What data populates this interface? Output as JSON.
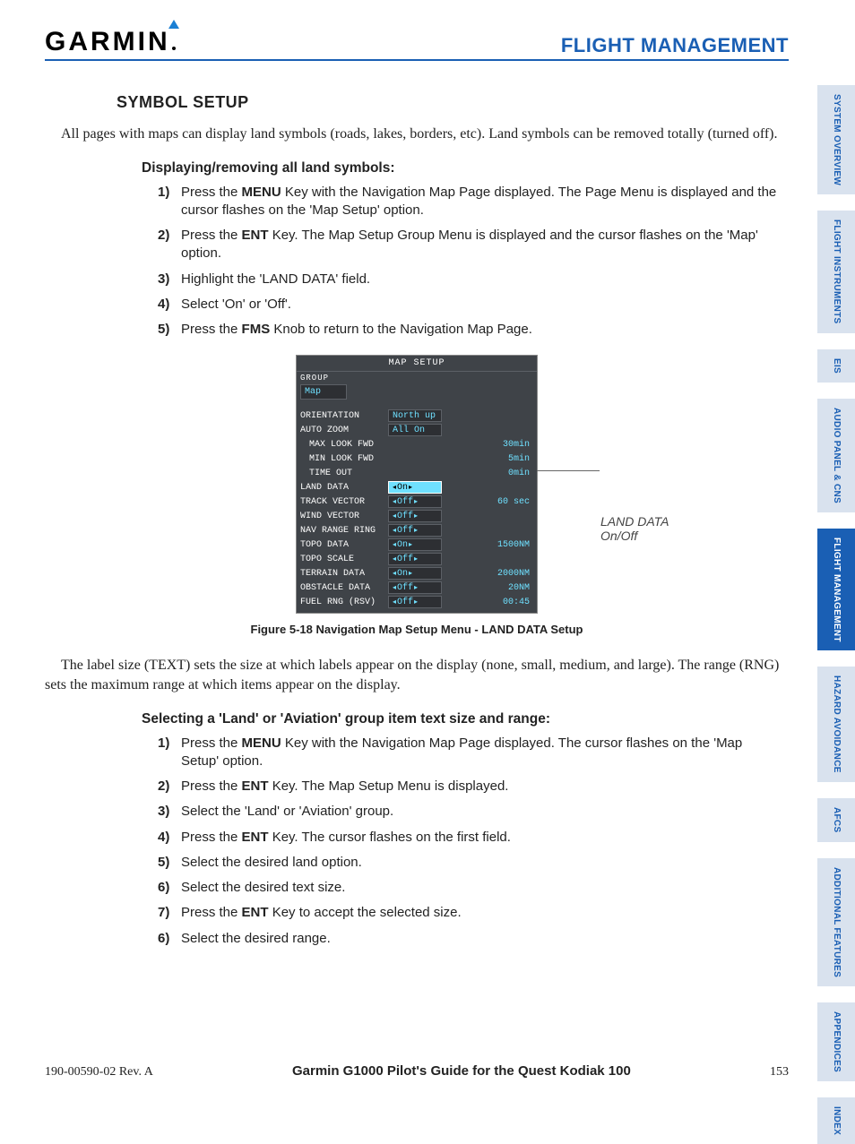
{
  "header": {
    "logo": "GARMIN",
    "chapter": "FLIGHT MANAGEMENT"
  },
  "section_title": "SYMBOL SETUP",
  "para1": "All pages with maps can display land symbols (roads, lakes, borders, etc).  Land symbols can be removed totally (turned off).",
  "subhead1": "Displaying/removing all land symbols:",
  "steps1": [
    {
      "n": "1)",
      "pre": "Press the ",
      "key": "MENU",
      "post": " Key with the Navigation Map Page displayed.  The Page Menu is displayed and the cursor flashes on the 'Map Setup' option."
    },
    {
      "n": "2)",
      "pre": "Press the ",
      "key": "ENT",
      "post": " Key.  The Map Setup Group Menu is displayed and the cursor flashes on the 'Map' option."
    },
    {
      "n": "3)",
      "pre": "",
      "key": "",
      "post": "Highlight the 'LAND DATA' field."
    },
    {
      "n": "4)",
      "pre": "",
      "key": "",
      "post": "Select 'On' or 'Off'."
    },
    {
      "n": "5)",
      "pre": "Press the ",
      "key": "FMS",
      "post": " Knob to return to the Navigation Map Page."
    }
  ],
  "figure": {
    "title": "MAP SETUP",
    "group_label": "GROUP",
    "group_value": "Map",
    "rows": [
      {
        "label": "ORIENTATION",
        "indent": false,
        "val": "North up",
        "box": true,
        "arrows": false,
        "extra": ""
      },
      {
        "label": "AUTO ZOOM",
        "indent": false,
        "val": "All On",
        "box": true,
        "arrows": false,
        "extra": ""
      },
      {
        "label": "MAX LOOK FWD",
        "indent": true,
        "val": "",
        "box": false,
        "arrows": false,
        "extra": "30min"
      },
      {
        "label": "MIN LOOK FWD",
        "indent": true,
        "val": "",
        "box": false,
        "arrows": false,
        "extra": "5min"
      },
      {
        "label": "TIME OUT",
        "indent": true,
        "val": "",
        "box": false,
        "arrows": false,
        "extra": "0min"
      },
      {
        "label": "LAND DATA",
        "indent": false,
        "val": "On",
        "box": true,
        "arrows": true,
        "extra": "",
        "hl": true
      },
      {
        "label": "TRACK VECTOR",
        "indent": false,
        "val": "Off",
        "box": true,
        "arrows": true,
        "extra": "60 sec"
      },
      {
        "label": "WIND VECTOR",
        "indent": false,
        "val": "Off",
        "box": true,
        "arrows": true,
        "extra": ""
      },
      {
        "label": "NAV RANGE RING",
        "indent": false,
        "val": "Off",
        "box": true,
        "arrows": true,
        "extra": ""
      },
      {
        "label": "TOPO DATA",
        "indent": false,
        "val": "On",
        "box": true,
        "arrows": true,
        "extra": "1500NM"
      },
      {
        "label": "TOPO SCALE",
        "indent": false,
        "val": "Off",
        "box": true,
        "arrows": true,
        "extra": ""
      },
      {
        "label": "TERRAIN DATA",
        "indent": false,
        "val": "On",
        "box": true,
        "arrows": true,
        "extra": "2000NM"
      },
      {
        "label": "OBSTACLE DATA",
        "indent": false,
        "val": "Off",
        "box": true,
        "arrows": true,
        "extra": "20NM"
      },
      {
        "label": "FUEL RNG (RSV)",
        "indent": false,
        "val": "Off",
        "box": true,
        "arrows": true,
        "extra": "00:45"
      }
    ],
    "callout_l1": "LAND DATA",
    "callout_l2": "On/Off",
    "caption": "Figure 5-18  Navigation Map Setup Menu - LAND DATA Setup"
  },
  "para2": "The label size (TEXT) sets the size at which labels appear on the display (none, small, medium, and large).  The range (RNG) sets the maximum range at which items appear on the display.",
  "subhead2": "Selecting a 'Land' or 'Aviation' group item text size and range:",
  "steps2": [
    {
      "n": "1)",
      "pre": "Press the ",
      "key": "MENU",
      "post": " Key with the Navigation Map Page displayed.  The cursor flashes on the 'Map Setup' option."
    },
    {
      "n": "2)",
      "pre": "Press the ",
      "key": "ENT",
      "post": " Key.  The Map Setup Menu is displayed."
    },
    {
      "n": "3)",
      "pre": "",
      "key": "",
      "post": "Select the 'Land'  or 'Aviation' group."
    },
    {
      "n": "4)",
      "pre": "Press the ",
      "key": "ENT",
      "post": " Key.  The cursor flashes on the first field."
    },
    {
      "n": "5)",
      "pre": "",
      "key": "",
      "post": "Select the desired land option."
    },
    {
      "n": "6)",
      "pre": "",
      "key": "",
      "post": "Select the desired text size."
    },
    {
      "n": "7)",
      "pre": "Press the ",
      "key": "ENT",
      "post": " Key to accept the selected size."
    },
    {
      "n": "6)",
      "pre": "",
      "key": "",
      "post": "Select the desired range."
    }
  ],
  "footer": {
    "rev": "190-00590-02  Rev. A",
    "guide": "Garmin G1000 Pilot's Guide for the Quest Kodiak 100",
    "page": "153"
  },
  "tabs": [
    {
      "label": "SYSTEM OVERVIEW",
      "active": false,
      "short": false
    },
    {
      "label": "FLIGHT INSTRUMENTS",
      "active": false,
      "short": false
    },
    {
      "label": "EIS",
      "active": false,
      "short": true
    },
    {
      "label": "AUDIO PANEL & CNS",
      "active": false,
      "short": false
    },
    {
      "label": "FLIGHT MANAGEMENT",
      "active": true,
      "short": false
    },
    {
      "label": "HAZARD AVOIDANCE",
      "active": false,
      "short": false
    },
    {
      "label": "AFCS",
      "active": false,
      "short": true
    },
    {
      "label": "ADDITIONAL FEATURES",
      "active": false,
      "short": false
    },
    {
      "label": "APPENDICES",
      "active": false,
      "short": false
    },
    {
      "label": "INDEX",
      "active": false,
      "short": true
    }
  ]
}
